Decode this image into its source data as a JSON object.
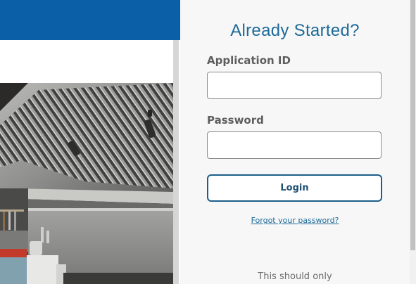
{
  "colors": {
    "brand_blue": "#0a5fa6",
    "title_blue": "#1d6a98",
    "panel_bg": "#f7f7f7",
    "button_border": "#1d5f8a"
  },
  "background": {
    "image_subject": "stainless steel kitchen exhaust hood"
  },
  "login": {
    "title": "Already Started?",
    "application_id_label": "Application ID",
    "application_id_value": "",
    "password_label": "Password",
    "password_value": "",
    "login_button": "Login",
    "forgot_link": "Forgot your password?",
    "note": "This should only"
  }
}
